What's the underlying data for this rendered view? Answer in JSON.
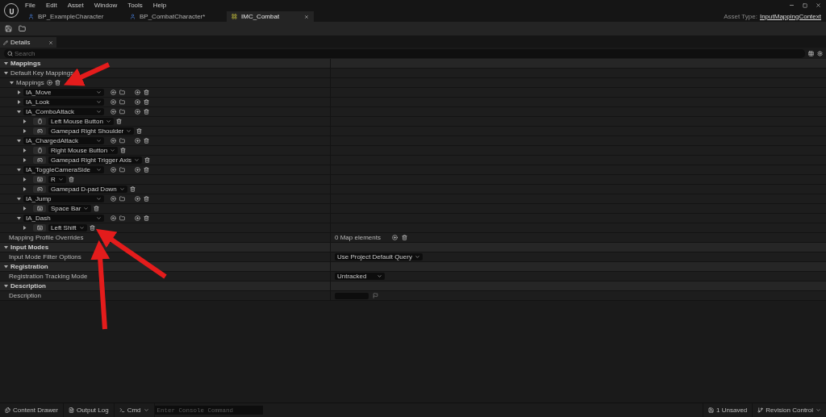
{
  "menu": [
    "File",
    "Edit",
    "Asset",
    "Window",
    "Tools",
    "Help"
  ],
  "tabs": [
    {
      "label": "BP_ExampleCharacter",
      "kind": "blueprint",
      "selected": false
    },
    {
      "label": "BP_CombatCharacter*",
      "kind": "blueprint",
      "selected": false
    },
    {
      "label": "IMC_Combat",
      "kind": "mapping",
      "selected": true
    }
  ],
  "asset_type": {
    "label": "Asset Type:",
    "value": "InputMappingContext"
  },
  "details_tab": {
    "title": "Details"
  },
  "search": {
    "placeholder": "Search"
  },
  "sections": [
    {
      "title": "Mappings",
      "expanded": true,
      "rows": [
        {
          "kind": "group",
          "label": "Default Key Mappings",
          "expanded": true,
          "list": {
            "label": "Mappings",
            "expanded": true,
            "actions": [
              {
                "name": "IA_Move",
                "expanded": false
              },
              {
                "name": "IA_Look",
                "expanded": false
              },
              {
                "name": "IA_ComboAttack",
                "expanded": true,
                "keys": [
                  {
                    "kind": "mouse",
                    "key": "Left Mouse Button"
                  },
                  {
                    "kind": "gamepad",
                    "key": "Gamepad Right Shoulder"
                  }
                ]
              },
              {
                "name": "IA_ChargedAttack",
                "expanded": true,
                "keys": [
                  {
                    "kind": "mouse",
                    "key": "Right Mouse Button"
                  },
                  {
                    "kind": "gamepad",
                    "key": "Gamepad Right Trigger Axis"
                  }
                ]
              },
              {
                "name": "IA_ToggleCameraSide",
                "expanded": true,
                "keys": [
                  {
                    "kind": "keyboard",
                    "key": "R"
                  },
                  {
                    "kind": "gamepad",
                    "key": "Gamepad D-pad Down"
                  }
                ]
              },
              {
                "name": "IA_Jump",
                "expanded": true,
                "keys": [
                  {
                    "kind": "keyboard",
                    "key": "Space Bar"
                  }
                ]
              },
              {
                "name": "IA_Dash",
                "expanded": true,
                "keys": [
                  {
                    "kind": "keyboard",
                    "key": "Left Shift"
                  }
                ]
              }
            ]
          }
        },
        {
          "kind": "map",
          "label": "Mapping Profile Overrides",
          "value": "0 Map elements"
        }
      ]
    },
    {
      "title": "Input Modes",
      "expanded": true,
      "rows": [
        {
          "kind": "dropdown",
          "label": "Input Mode Filter Options",
          "value": "Use Project Default Query"
        }
      ]
    },
    {
      "title": "Registration",
      "expanded": true,
      "rows": [
        {
          "kind": "dropdown",
          "label": "Registration Tracking Mode",
          "value": "Untracked"
        }
      ]
    },
    {
      "title": "Description",
      "expanded": true,
      "rows": [
        {
          "kind": "text",
          "label": "Description"
        }
      ]
    }
  ],
  "status_bar": {
    "left": [
      {
        "label": "Content Drawer",
        "kind": "drawer"
      },
      {
        "label": "Output Log",
        "kind": "log"
      }
    ],
    "cmd": {
      "label": "Cmd",
      "placeholder": "Enter Console Command"
    },
    "right": [
      {
        "label": "1 Unsaved",
        "kind": "unsaved"
      },
      {
        "label": "Revision Control",
        "kind": "revision"
      }
    ]
  }
}
